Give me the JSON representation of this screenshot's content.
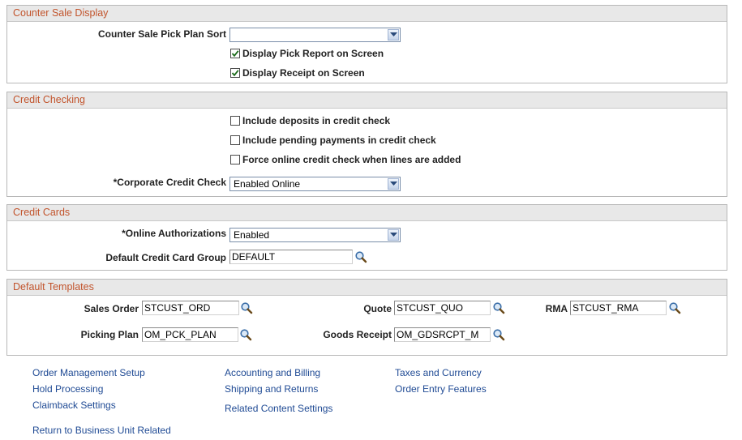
{
  "counter_sale": {
    "header": "Counter Sale Display",
    "pick_plan_sort_label": "Counter Sale Pick Plan Sort",
    "pick_plan_sort_value": "",
    "display_pick_report_label": "Display Pick Report on Screen",
    "display_pick_report_checked": true,
    "display_receipt_label": "Display Receipt on Screen",
    "display_receipt_checked": true
  },
  "credit_checking": {
    "header": "Credit Checking",
    "include_deposits_label": "Include deposits in credit check",
    "include_deposits_checked": false,
    "include_pending_label": "Include pending payments in credit check",
    "include_pending_checked": false,
    "force_online_label": "Force online credit check when lines are added",
    "force_online_checked": false,
    "corporate_check_label": "*Corporate Credit Check",
    "corporate_check_value": "Enabled Online"
  },
  "credit_cards": {
    "header": "Credit Cards",
    "online_auth_label": "*Online Authorizations",
    "online_auth_value": "Enabled",
    "default_group_label": "Default Credit Card Group",
    "default_group_value": "DEFAULT"
  },
  "default_templates": {
    "header": "Default Templates",
    "sales_order_label": "Sales Order",
    "sales_order_value": "STCUST_ORD",
    "quote_label": "Quote",
    "quote_value": "STCUST_QUO",
    "rma_label": "RMA",
    "rma_value": "STCUST_RMA",
    "picking_plan_label": "Picking Plan",
    "picking_plan_value": "OM_PCK_PLAN",
    "goods_receipt_label": "Goods Receipt",
    "goods_receipt_value": "OM_GDSRCPT_M"
  },
  "links": {
    "order_management_setup": "Order Management Setup",
    "hold_processing": "Hold Processing",
    "claimback_settings": "Claimback Settings",
    "accounting_and_billing": "Accounting and Billing",
    "shipping_and_returns": "Shipping and Returns",
    "related_content_settings": "Related Content Settings",
    "taxes_and_currency": "Taxes and Currency",
    "order_entry_features": "Order Entry Features",
    "return_to_bu": "Return to Business Unit Related"
  },
  "colors": {
    "section_header_text": "#c2542c",
    "link": "#1f4a94"
  }
}
